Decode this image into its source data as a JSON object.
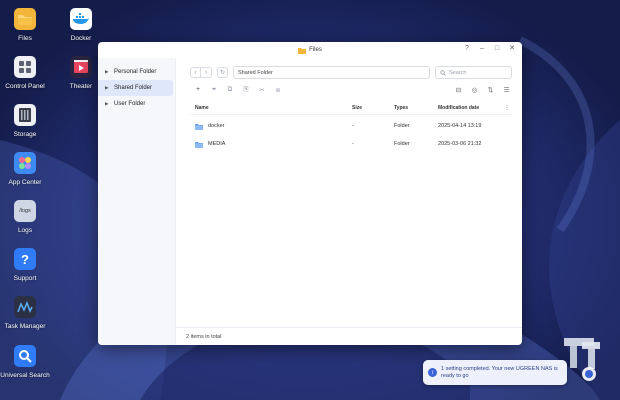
{
  "desktop": {
    "icons": [
      {
        "label": "Files",
        "icon": "files-icon",
        "color": "#f3b53a"
      },
      {
        "label": "Docker",
        "icon": "docker-icon",
        "color": "#2496ed"
      },
      {
        "label": "Control Panel",
        "icon": "control-panel-icon",
        "color": "#5b6272"
      },
      {
        "label": "Theater",
        "icon": "theater-icon",
        "color": "#e94560"
      },
      {
        "label": "Storage",
        "icon": "storage-icon",
        "color": "#3a3f4b"
      },
      {
        "label": "App Center",
        "icon": "app-center-icon",
        "color": "#3d8bf2"
      },
      {
        "label": "Logs",
        "icon": "logs-icon",
        "color": "#cfd6e4"
      },
      {
        "label": "Support",
        "icon": "support-icon",
        "color": "#2f7cf6"
      },
      {
        "label": "Task Manager",
        "icon": "task-manager-icon",
        "color": "#2b3045"
      },
      {
        "label": "Universal Search",
        "icon": "universal-search-icon",
        "color": "#2f7cf6"
      }
    ],
    "logs_tile_text": "/logs"
  },
  "window": {
    "title": "Files",
    "controls": [
      "?",
      "–",
      "□",
      "✕"
    ],
    "sidebar": [
      {
        "label": "Personal Folder",
        "active": false
      },
      {
        "label": "Shared Folder",
        "active": true
      },
      {
        "label": "User Folder",
        "active": false
      }
    ],
    "nav": {
      "back": "‹",
      "forward": "›",
      "refresh": "↻",
      "path": "Shared Folder",
      "search_placeholder": "Search"
    },
    "toolbar": {
      "new": "+",
      "tools": [
        "⏷",
        "⧉",
        "⎘",
        "✂",
        "⊚"
      ],
      "view_tools": [
        "⊟",
        "◎",
        "⇅",
        "☰"
      ]
    },
    "table": {
      "headers": {
        "name": "Name",
        "size": "Size",
        "type": "Types",
        "modified": "Modification date",
        "more": "⋮"
      },
      "rows": [
        {
          "name": "docker",
          "size": "-",
          "type": "Folder",
          "modified": "2025-04-14 13:19"
        },
        {
          "name": "MEDIA",
          "size": "-",
          "type": "Folder",
          "modified": "2025-03-06 21:32"
        }
      ]
    },
    "status": "2 items in total"
  },
  "toast": {
    "message": "1 setting completed. Your new UGREEN NAS is ready to go"
  },
  "colors": {
    "accent": "#3a63d8",
    "folder": "#6aa5f0"
  }
}
